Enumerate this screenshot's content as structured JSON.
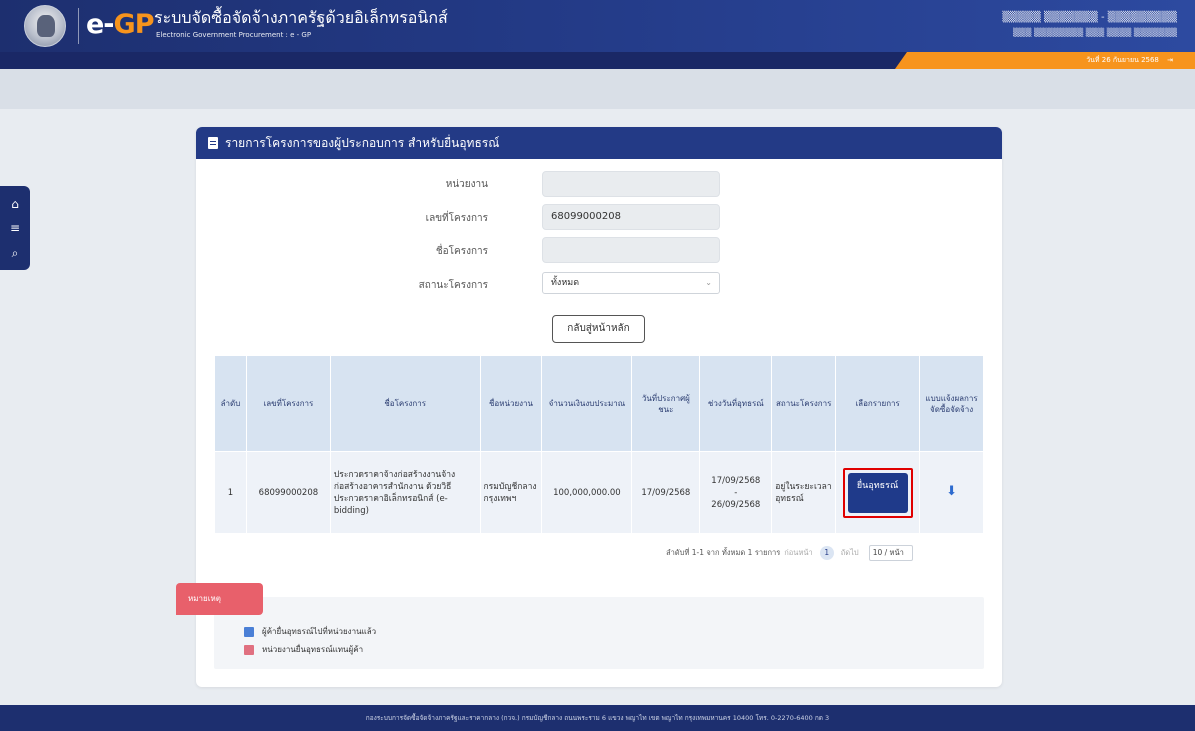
{
  "header": {
    "logo_e": "e-",
    "logo_gp": "GP",
    "title_th": "ระบบจัดซื้อจัดจ้างภาครัฐด้วยอิเล็กทรอนิกส์",
    "title_en": "Electronic Government Procurement : e - GP",
    "date_text": "วันที่ 26 กันยายน 2568"
  },
  "card": {
    "title": "รายการโครงการของผู้ประกอบการ สำหรับยื่นอุทธรณ์"
  },
  "form": {
    "agency_label": "หน่วยงาน",
    "agency_value": "",
    "project_no_label": "เลขที่โครงการ",
    "project_no_value": "68099000208",
    "project_name_label": "ชื่อโครงการ",
    "project_name_value": "",
    "status_label": "สถานะโครงการ",
    "status_value": "ทั้งหมด"
  },
  "back_button": "กลับสู่หน้าหลัก",
  "table": {
    "headers": [
      "ลำดับ",
      "เลขที่โครงการ",
      "ชื่อโครงการ",
      "ชื่อหน่วยงาน",
      "จำนวนเงินงบประมาณ",
      "วันที่ประกาศผู้ชนะ",
      "ช่วงวันที่อุทธรณ์",
      "สถานะโครงการ",
      "เลือกรายการ",
      "แบบแจ้งผลการจัดซื้อจัดจ้าง"
    ],
    "rows": [
      {
        "no": "1",
        "project_no": "68099000208",
        "project_name": "ประกวดราคาจ้างก่อสร้างงานจ้างก่อสร้างอาคารสำนักงาน ด้วยวิธีประกวดราคาอิเล็กทรอนิกส์ (e-bidding)",
        "agency": "กรมบัญชีกลาง กรุงเทพฯ",
        "budget": "100,000,000.00",
        "winner_date": "17/09/2568",
        "appeal_from": "17/09/2568",
        "appeal_sep": "-",
        "appeal_to": "26/09/2568",
        "status": "อยู่ในระยะเวลาอุทธรณ์",
        "action_label": "ยื่นอุทธรณ์"
      }
    ]
  },
  "pager": {
    "summary": "ลำดับที่ 1-1 จาก ทั้งหมด 1 รายการ",
    "prev": "ก่อนหน้า",
    "page": "1",
    "next": "ถัดไป",
    "page_size": "10 / หน้า"
  },
  "remarks": {
    "tab_label": "หมายเหตุ",
    "items": [
      "ผู้ค้ายื่นอุทธรณ์ไปที่หน่วยงานแล้ว",
      "หน่วยงานยื่นอุทธรณ์แทนผู้ค้า"
    ]
  },
  "footer": "กองระบบการจัดซื้อจัดจ้างภาครัฐและราคากลาง (กวจ.) กรมบัญชีกลาง ถนนพระราม 6 แขวง พญาไท เขต พญาไท กรุงเทพมหานคร 10400 โทร. 0-2270-6400 กด 3",
  "colors": {
    "primary": "#233a86",
    "accent": "#f7941d",
    "highlight": "#e00000"
  }
}
